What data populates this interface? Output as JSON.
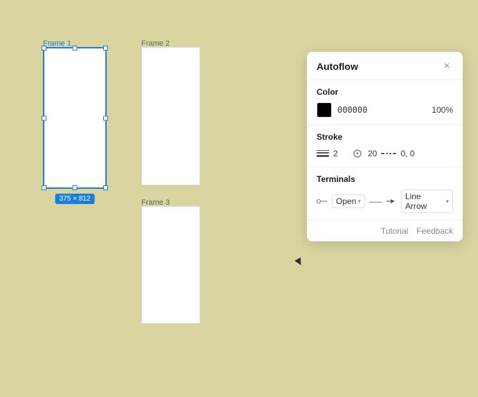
{
  "canvas": {
    "background": "#d9d4a0"
  },
  "frames": [
    {
      "id": "frame1",
      "label": "Frame 1",
      "selected": true,
      "size_badge": "375 × 812"
    },
    {
      "id": "frame2",
      "label": "Frame 2",
      "selected": false
    },
    {
      "id": "frame3",
      "label": "Frame 3",
      "selected": false
    }
  ],
  "panel": {
    "title": "Autoflow",
    "close_label": "×",
    "color_section": {
      "label": "Color",
      "swatch": "#000000",
      "hex": "000000",
      "opacity": "100%"
    },
    "stroke_section": {
      "label": "Stroke",
      "width": "2",
      "radius": "20",
      "dash": "0, 0"
    },
    "terminals_section": {
      "label": "Terminals",
      "start_label": "Open",
      "end_label": "Line Arrow"
    },
    "footer": {
      "tutorial_label": "Tutorial",
      "feedback_label": "Feedback"
    }
  }
}
